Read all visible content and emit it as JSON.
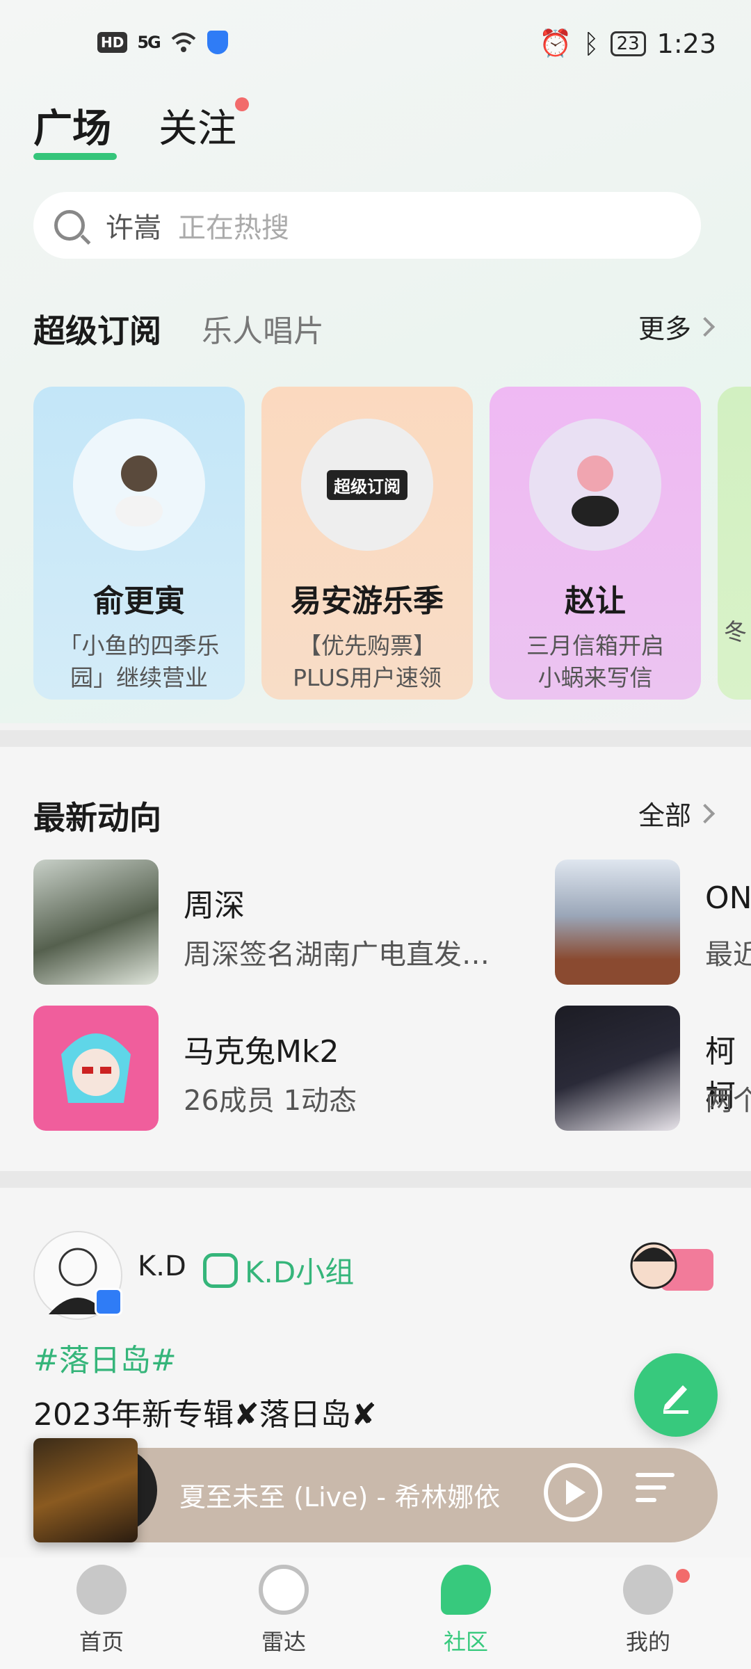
{
  "status_bar": {
    "hd": "HD",
    "signal": "5G",
    "battery": "23",
    "time": "1:23"
  },
  "tabs": [
    {
      "label": "广场",
      "active": true
    },
    {
      "label": "关注",
      "active": false,
      "has_dot": true
    }
  ],
  "search": {
    "keyword": "许嵩",
    "hint": "正在热搜"
  },
  "subscription": {
    "title": "超级订阅",
    "subtitle": "乐人唱片",
    "more": "更多",
    "cards": [
      {
        "name": "俞更寅",
        "desc": "「小鱼的四季乐园」继续营业",
        "bg": "#bfe3f6"
      },
      {
        "name": "易安游乐季",
        "desc": "【优先购票】PLUS用户速领",
        "bg": "#f9d6bb",
        "avatar_text": "超级订阅"
      },
      {
        "name": "赵让",
        "desc": "三月信箱开启 小蜗来写信",
        "bg": "#eeb9f2"
      },
      {
        "name": "",
        "desc": "冬",
        "bg": "#cdeebd"
      }
    ]
  },
  "latest": {
    "title": "最新动向",
    "all": "全部",
    "items": [
      {
        "name": "周深",
        "desc": "周深签名湖南广电直发…"
      },
      {
        "name": "ON",
        "desc": "最近"
      },
      {
        "name": "马克兔Mk2",
        "desc": "26成员 1动态"
      },
      {
        "name": "柯柯",
        "desc": "两个"
      }
    ]
  },
  "post": {
    "author": "K.D",
    "group": "K.D小组",
    "hashtag": "#落日岛#",
    "title": "2023年新专辑✘落日岛✘"
  },
  "player": {
    "song": "夏至未至 (Live) - 希林娜依"
  },
  "nav": [
    {
      "label": "首页"
    },
    {
      "label": "雷达"
    },
    {
      "label": "社区",
      "active": true
    },
    {
      "label": "我的",
      "has_dot": true
    }
  ],
  "colors": {
    "accent": "#35c57a",
    "badge": "#f26b6b",
    "player_bg": "#c9b9ab"
  }
}
